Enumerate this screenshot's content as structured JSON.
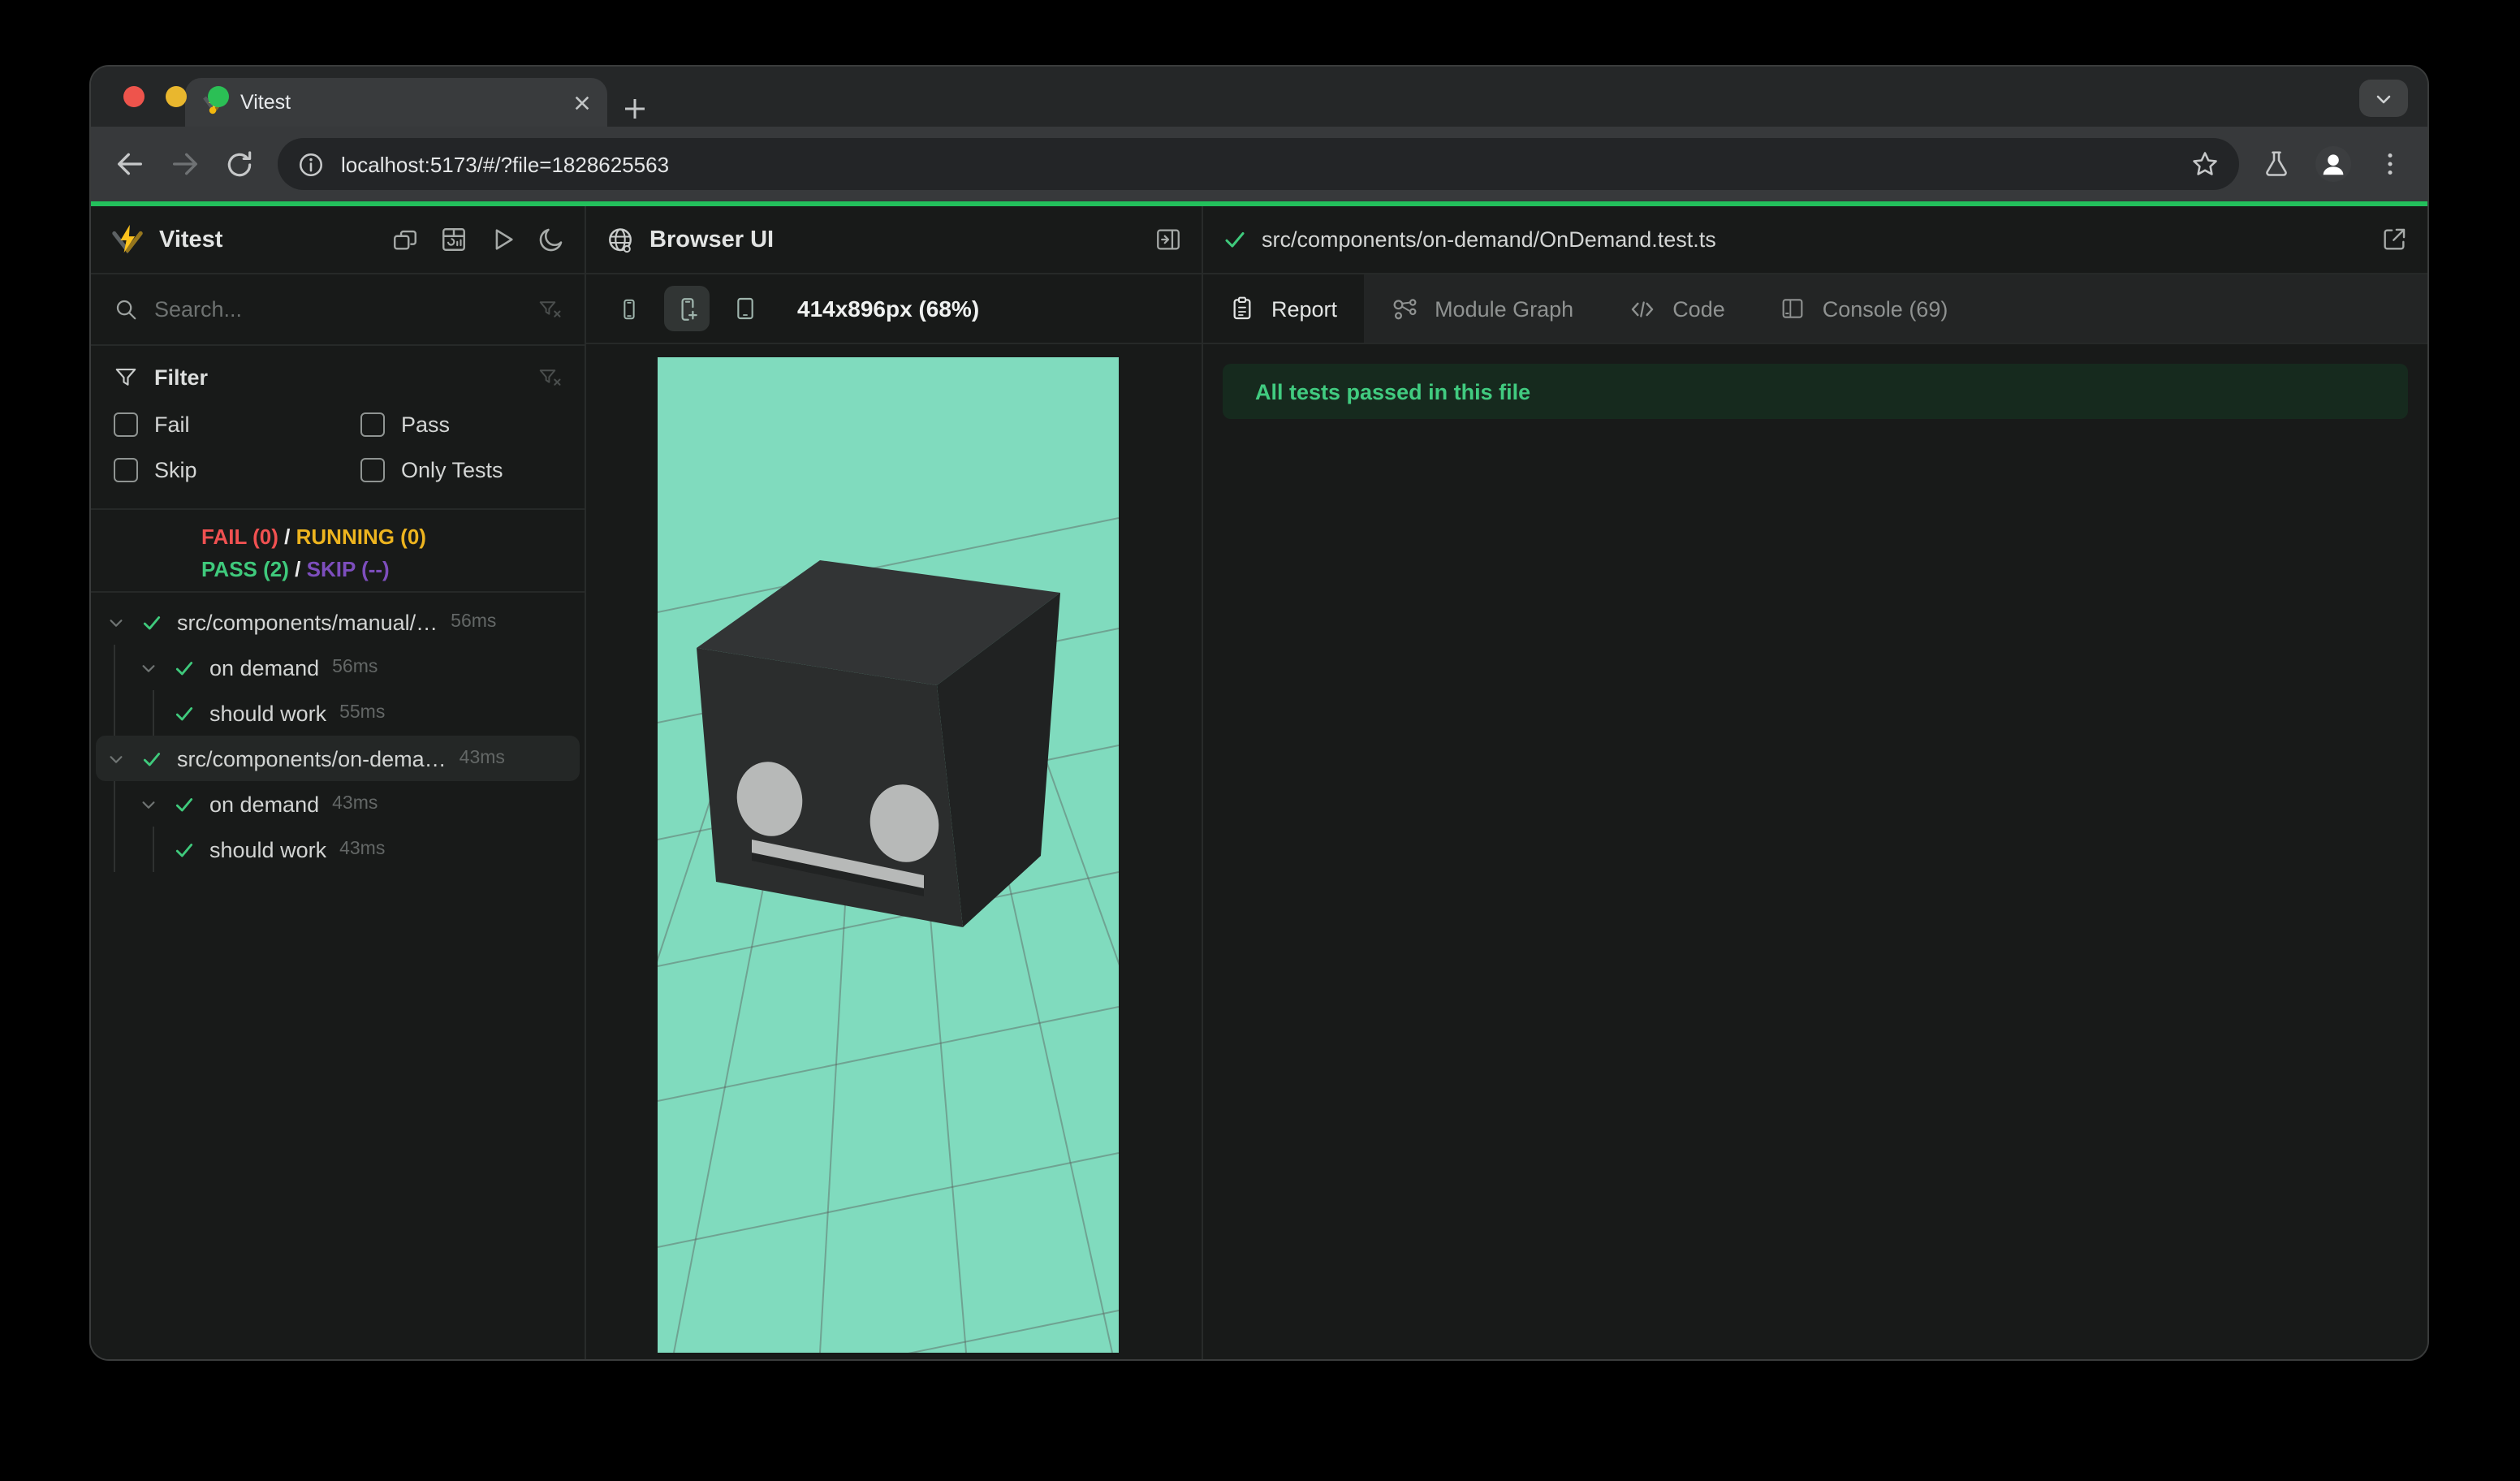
{
  "chrome": {
    "tab_title": "Vitest",
    "url": "localhost:5173/#/?file=1828625563",
    "accent_color": "#23c05c",
    "traffic_colors": {
      "close": "#ee544c",
      "minimize": "#e9b72e",
      "zoom": "#2bbf55"
    }
  },
  "sidebar": {
    "title": "Vitest",
    "search_placeholder": "Search...",
    "filter": {
      "title": "Filter",
      "options": [
        {
          "label": "Fail"
        },
        {
          "label": "Pass"
        },
        {
          "label": "Skip"
        },
        {
          "label": "Only Tests"
        }
      ]
    },
    "summary": {
      "fail": "FAIL (0)",
      "running": "RUNNING (0)",
      "pass": "PASS (2)",
      "skip": "SKIP (--)",
      "separator": "/"
    },
    "tree": [
      {
        "label": "src/components/manual/…",
        "time": "56ms"
      },
      {
        "label": "on demand",
        "time": "56ms"
      },
      {
        "label": "should work",
        "time": "55ms"
      },
      {
        "label": "src/components/on-dema…",
        "time": "43ms"
      },
      {
        "label": "on demand",
        "time": "43ms"
      },
      {
        "label": "should work",
        "time": "43ms"
      }
    ]
  },
  "browser_panel": {
    "title": "Browser UI",
    "viewport_label": "414x896px (68%)",
    "viewport_color": "#80dbbe"
  },
  "report_panel": {
    "file_path": "src/components/on-demand/OnDemand.test.ts",
    "tabs": [
      {
        "label": "Report"
      },
      {
        "label": "Module Graph"
      },
      {
        "label": "Code"
      },
      {
        "label": "Console (69)"
      }
    ],
    "banner": "All tests passed in this file"
  },
  "colors": {
    "fail_red": "#f05151",
    "running_yellow": "#edb41f",
    "pass_green": "#3fca7c",
    "skip_purple": "#7d4ebd",
    "banner_bg": "#162a1e",
    "banner_text": "#41cb80"
  }
}
